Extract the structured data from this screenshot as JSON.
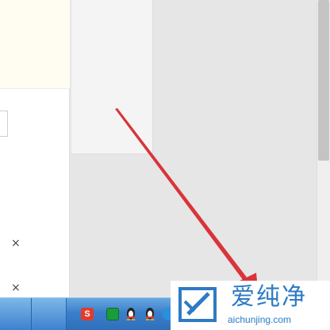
{
  "left_panel": {
    "close_buttons": [
      {
        "label": "×"
      },
      {
        "label": "×"
      }
    ]
  },
  "taskbar": {
    "tray_icons": [
      {
        "name": "sogou-input-icon",
        "glyph": "S",
        "color": "#e23b2b"
      },
      {
        "name": "green-app-icon",
        "glyph": "",
        "color": "#1a9b3c"
      },
      {
        "name": "qq-penguin-icon",
        "glyph": "",
        "color": "#222222"
      },
      {
        "name": "qq-penguin-icon",
        "glyph": "",
        "color": "#222222"
      },
      {
        "name": "shield-icon",
        "glyph": "",
        "color": "#2b8fe0"
      }
    ]
  },
  "watermark": {
    "title": "爱纯净",
    "url": "aichunjing.com",
    "color": "#2d7bc5"
  },
  "annotation": {
    "arrow_color": "#d9343a"
  }
}
